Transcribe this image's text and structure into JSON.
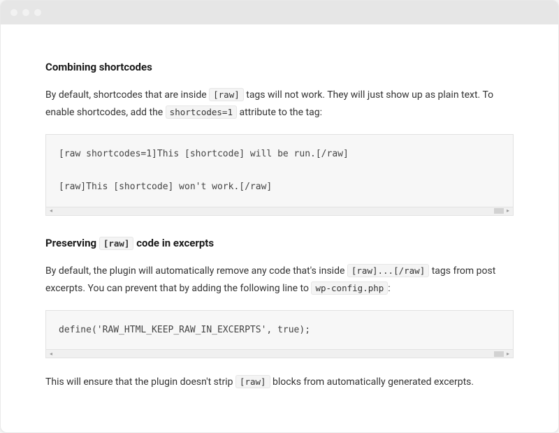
{
  "section1": {
    "heading": "Combining shortcodes",
    "para_before": "By default, shortcodes that are inside ",
    "para_tag": "[raw]",
    "para_mid": " tags will not work. They will just show up as plain text. To enable shortcodes, add the ",
    "para_attr": "shortcodes=1",
    "para_after": " attribute to the tag:",
    "code": "[raw shortcodes=1]This [shortcode] will be run.[/raw]\n\n[raw]This [shortcode] won't work.[/raw]"
  },
  "section2": {
    "heading_before": "Preserving ",
    "heading_code": "[raw]",
    "heading_after": " code in excerpts",
    "para_before": "By default, the plugin will automatically remove any code that's inside ",
    "para_tag": "[raw]...[/raw]",
    "para_mid": " tags from post excerpts. You can prevent that by adding the following line to ",
    "para_file": "wp-config.php",
    "para_after": ":",
    "code": "define('RAW_HTML_KEEP_RAW_IN_EXCERPTS', true);",
    "note_before": "This will ensure that the plugin doesn't strip ",
    "note_tag": "[raw]",
    "note_after": " blocks from automatically generated excerpts."
  }
}
